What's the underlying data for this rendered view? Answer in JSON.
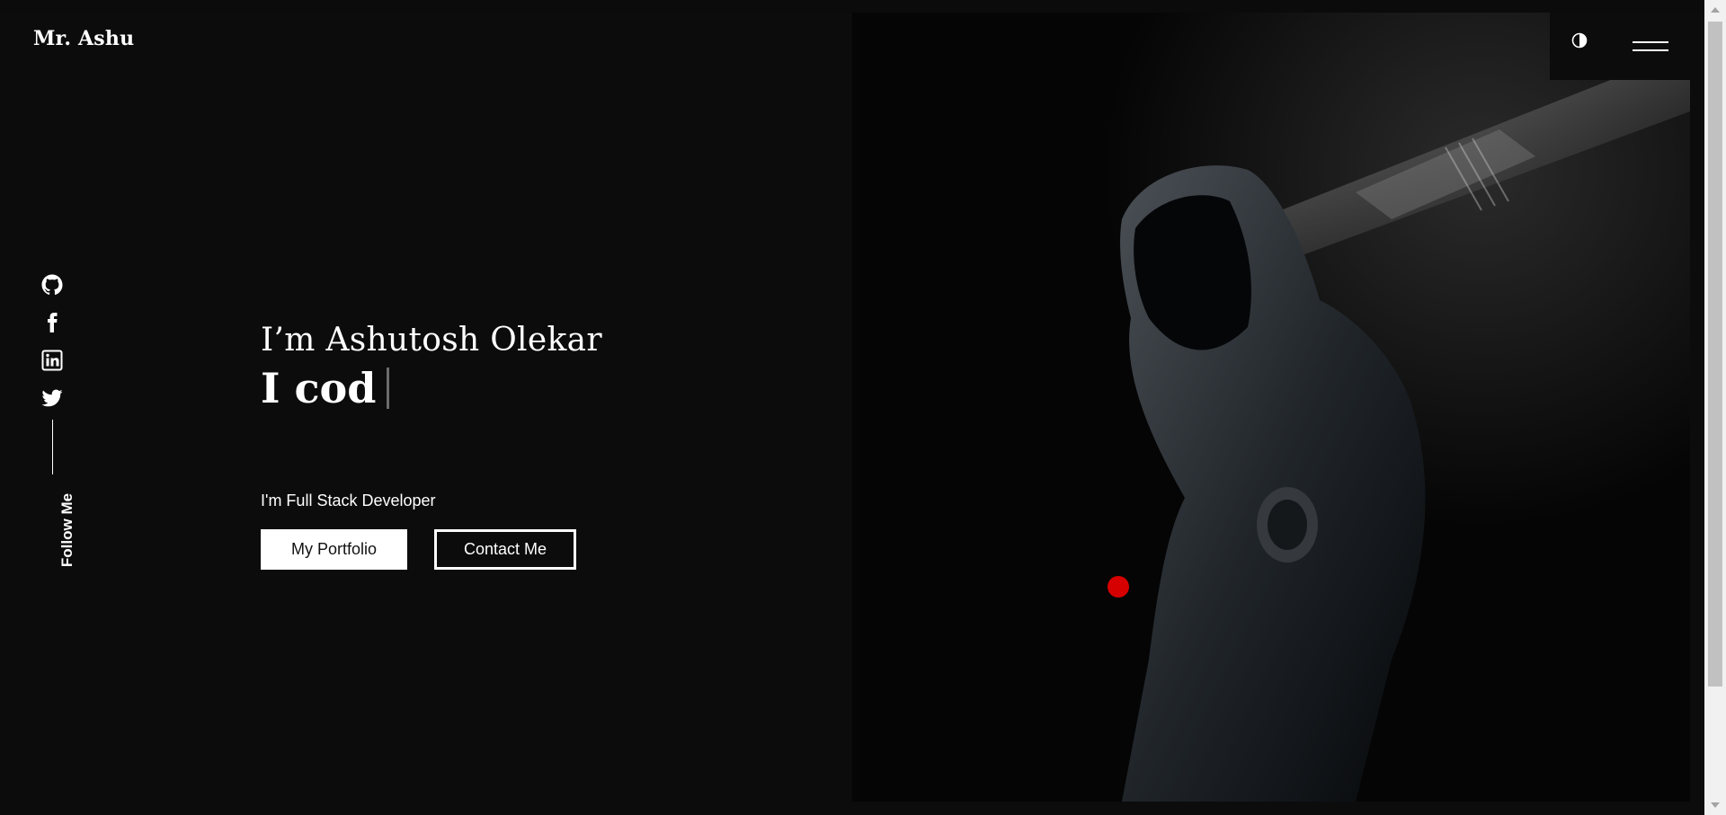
{
  "header": {
    "brand": "Mr. Ashu",
    "theme_toggle_icon": "contrast-icon",
    "menu_icon": "hamburger-icon"
  },
  "social": {
    "items": [
      {
        "icon": "github-icon"
      },
      {
        "icon": "facebook-icon"
      },
      {
        "icon": "linkedin-icon"
      },
      {
        "icon": "twitter-icon"
      }
    ],
    "follow_label": "Follow Me"
  },
  "hero": {
    "greeting": "I’m Ashutosh Olekar",
    "typed_text": "I cod",
    "role": "I'm Full Stack Developer",
    "portfolio_button": "My Portfolio",
    "contact_button": "Contact Me",
    "image_subject": "hooded-person-photo"
  },
  "colors": {
    "background": "#0c0c0c",
    "text": "#ffffff",
    "cursor_dot": "#d60000",
    "typed_cursor": "#6c6c6c"
  }
}
